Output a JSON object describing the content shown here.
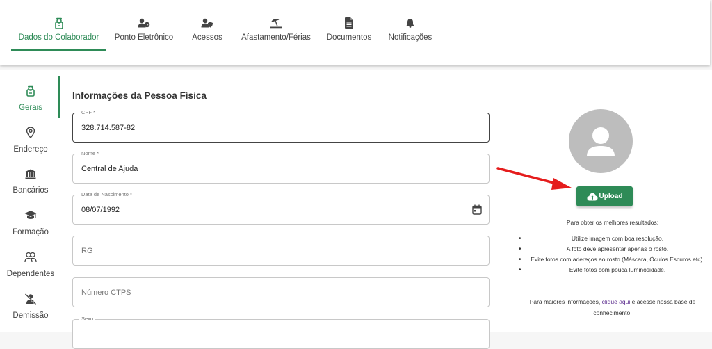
{
  "top_tabs": [
    {
      "label": "Dados do Colaborador"
    },
    {
      "label": "Ponto Eletrônico"
    },
    {
      "label": "Acessos"
    },
    {
      "label": "Afastamento/Férias"
    },
    {
      "label": "Documentos"
    },
    {
      "label": "Notificações"
    }
  ],
  "side_nav": [
    {
      "label": "Gerais"
    },
    {
      "label": "Endereço"
    },
    {
      "label": "Bancários"
    },
    {
      "label": "Formação"
    },
    {
      "label": "Dependentes"
    },
    {
      "label": "Demissão"
    }
  ],
  "section_title": "Informações da Pessoa Física",
  "fields": {
    "cpf": {
      "label": "CPF *",
      "value": "328.714.587-82"
    },
    "nome": {
      "label": "Nome *",
      "value": "Central de Ajuda"
    },
    "nascimento": {
      "label": "Data de Nascimento *",
      "value": "08/07/1992"
    },
    "rg": {
      "placeholder": "RG"
    },
    "ctps": {
      "placeholder": "Número CTPS"
    },
    "sexo": {
      "label": "Sexo"
    }
  },
  "upload_label": "Upload",
  "tips_title": "Para obter os melhores resultados:",
  "tips": [
    "Utilize imagem com boa resolução.",
    "A foto deve apresentar apenas o rosto.",
    "Evite fotos com adereços ao rosto (Máscara, Óculos Escuros etc).",
    "Evite fotos com pouca luminosidade."
  ],
  "more_info": {
    "prefix": "Para maiores informações, ",
    "link": "clique aqui",
    "suffix": " e acesse nossa base de conhecimento."
  },
  "colors": {
    "accent": "#2e8b57",
    "annotation_arrow": "#e51c1c"
  }
}
